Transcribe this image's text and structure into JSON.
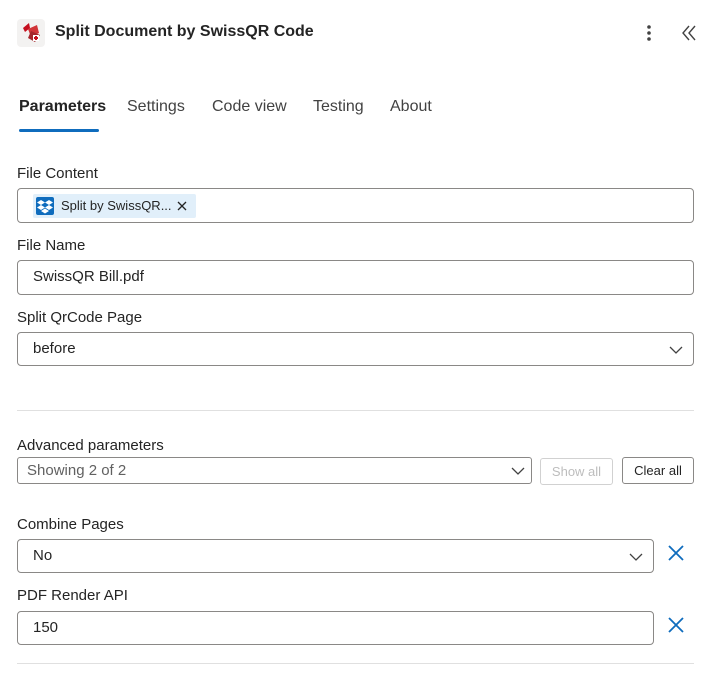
{
  "header": {
    "title": "Split Document by SwissQR Code",
    "logo_icon": "swissqr-app-logo",
    "more_icon": "more-vertical-icon",
    "collapse_icon": "double-chevron-left-icon"
  },
  "tabs": [
    {
      "label": "Parameters",
      "active": true
    },
    {
      "label": "Settings",
      "active": false
    },
    {
      "label": "Code view",
      "active": false
    },
    {
      "label": "Testing",
      "active": false
    },
    {
      "label": "About",
      "active": false
    }
  ],
  "params": {
    "file_content": {
      "label": "File Content",
      "token_text": "Split by SwissQR...",
      "token_icon": "dropbox-icon"
    },
    "file_name": {
      "label": "File Name",
      "value": "SwissQR Bill.pdf"
    },
    "split_page": {
      "label": "Split QrCode Page",
      "value": "before"
    }
  },
  "advanced": {
    "label": "Advanced parameters",
    "selected": "Showing 2 of 2",
    "show_all": "Show all",
    "clear_all": "Clear all",
    "combine_pages": {
      "label": "Combine Pages",
      "value": "No"
    },
    "pdf_render_api": {
      "label": "PDF Render API",
      "value": "150"
    }
  },
  "colors": {
    "accent": "#0f6cbd",
    "token_bg": "#e1effa",
    "border": "#8a8886",
    "divider": "#e0e0e0"
  }
}
